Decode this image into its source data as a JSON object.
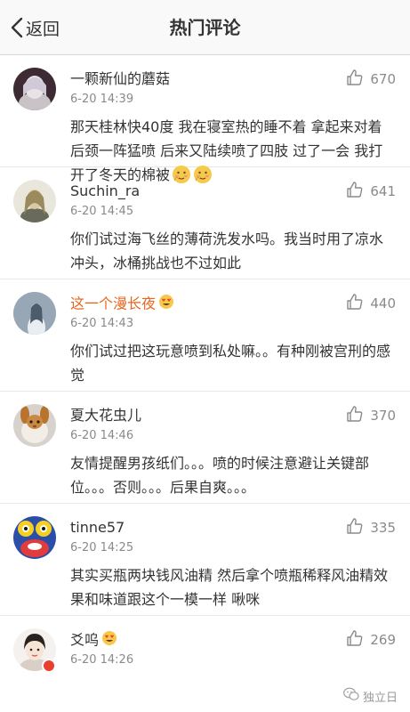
{
  "navbar": {
    "back_label": "返回",
    "title": "热门评论"
  },
  "comments": [
    {
      "username": "一颗新仙的蘑菇",
      "time": "6-20 14:39",
      "likes": "670",
      "text": "那天桂林快40度 我在寝室热的睡不着 拿起来对着后颈一阵猛喷 后来又陆续喷了四肢 过了一会 我打开了冬天的棉被",
      "trailing_emoji": [
        "shy-face-emoji",
        "shy-face-emoji"
      ]
    },
    {
      "username": "Suchin_ra",
      "time": "6-20 14:45",
      "likes": "641",
      "text": "你们试过海飞丝的薄荷洗发水吗。我当时用了凉水冲头，冰桶挑战也不过如此"
    },
    {
      "username": "这一个漫长夜",
      "username_color": "#e8661f",
      "username_badge": "heart-eyes-emoji",
      "time": "6-20 14:43",
      "likes": "440",
      "text": "你们试过把这玩意喷到私处嘛。。有种刚被宫刑的感觉"
    },
    {
      "username": "夏大花虫儿",
      "time": "6-20 14:46",
      "likes": "370",
      "text": "友情提醒男孩纸们。。。喷的时候注意避让关键部位。。。否则。。。后果自爽。。。"
    },
    {
      "username": "tinne57",
      "time": "6-20 14:25",
      "likes": "335",
      "text": "其实买瓶两块钱风油精 然后拿个喷瓶稀释风油精效果和味道跟这个一模一样 啾咪"
    },
    {
      "username": "爻呜",
      "username_badge": "heart-eyes-emoji",
      "verified_badge": true,
      "time": "6-20 14:26",
      "likes": "269",
      "text": ""
    }
  ],
  "watermark": {
    "label": "独立日",
    "icon": "wechat-icon"
  },
  "colors": {
    "accent_orange": "#e8661f",
    "meta_gray": "#8a8a8a",
    "text": "#333333",
    "navbar_bg": "#f9f9f9"
  }
}
